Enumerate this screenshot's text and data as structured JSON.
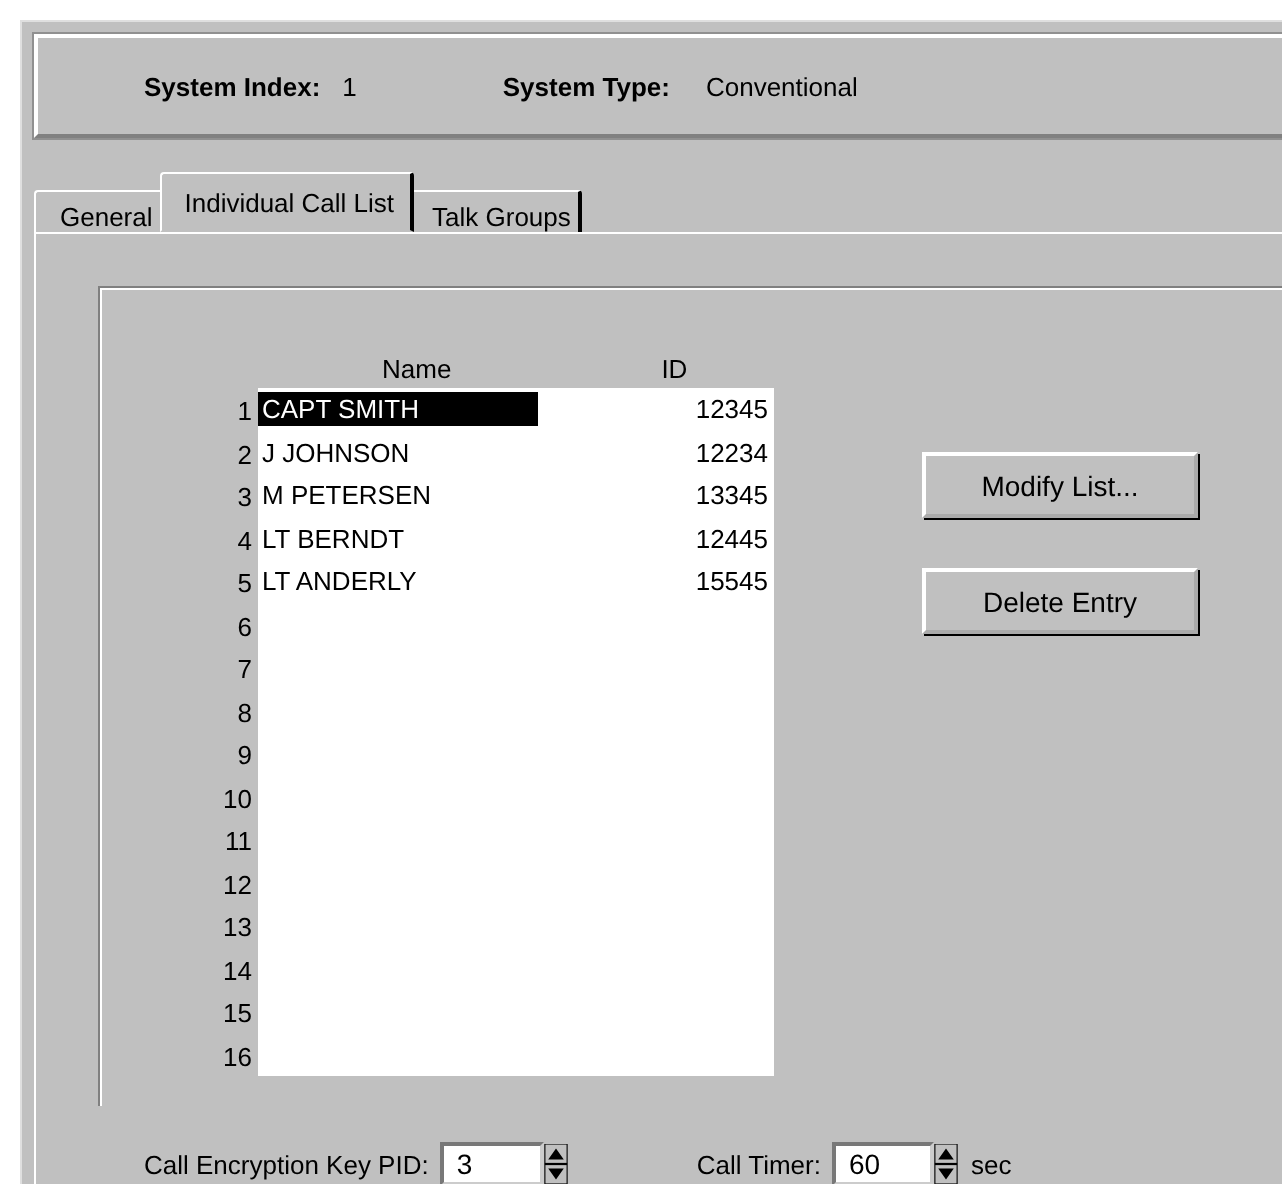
{
  "header": {
    "system_index_label": "System Index:",
    "system_index": "1",
    "system_type_label": "System Type:",
    "system_type": "Conventional"
  },
  "tabs": [
    {
      "label": "General",
      "selected": false
    },
    {
      "label": "Individual Call List",
      "selected": true
    },
    {
      "label": "Talk Groups",
      "selected": false
    }
  ],
  "call_list": {
    "columns": [
      "Name",
      "ID"
    ],
    "rows": [
      {
        "number": "1",
        "name": "CAPT SMITH",
        "id": "12345",
        "selected": true
      },
      {
        "number": "2",
        "name": "J JOHNSON",
        "id": "12234",
        "selected": false
      },
      {
        "number": "3",
        "name": "M PETERSEN",
        "id": "13345",
        "selected": false
      },
      {
        "number": "4",
        "name": "LT BERNDT",
        "id": "12445",
        "selected": false
      },
      {
        "number": "5",
        "name": "LT ANDERLY",
        "id": "15545",
        "selected": false
      },
      {
        "number": "6"
      },
      {
        "number": "7"
      },
      {
        "number": "8"
      },
      {
        "number": "9"
      },
      {
        "number": "10"
      },
      {
        "number": "11"
      },
      {
        "number": "12"
      },
      {
        "number": "13"
      },
      {
        "number": "14"
      },
      {
        "number": "15"
      },
      {
        "number": "16"
      }
    ]
  },
  "buttons": [
    "Modify List...",
    "Delete Entry"
  ],
  "call_encryption_key_pid": {
    "label": "Call Encryption Key PID:",
    "value": "3"
  },
  "call_timer": {
    "label": "Call Timer:",
    "value": "60",
    "unit": "sec"
  }
}
